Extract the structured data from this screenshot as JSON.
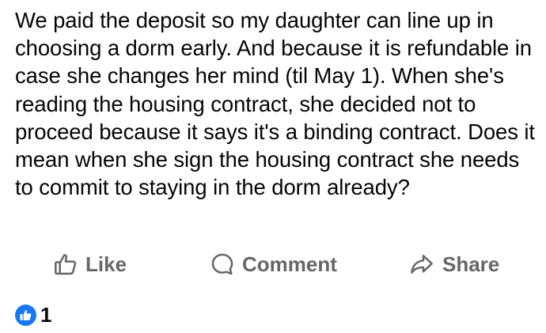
{
  "post": {
    "text": "We paid the deposit so my daughter can line up in choosing a dorm early. And because it is refundable in case she changes her mind (til May 1). When she's reading the housing contract, she decided not to proceed because it says it's a binding contract. Does it mean when she sign the housing contract she needs to commit to staying in the dorm already?"
  },
  "actions": {
    "like_label": "Like",
    "comment_label": "Comment",
    "share_label": "Share"
  },
  "reactions": {
    "count": "1",
    "icon": "like-badge-icon"
  },
  "colors": {
    "action_text": "#65676b",
    "body_text": "#050505",
    "like_blue": "#1877f2"
  }
}
